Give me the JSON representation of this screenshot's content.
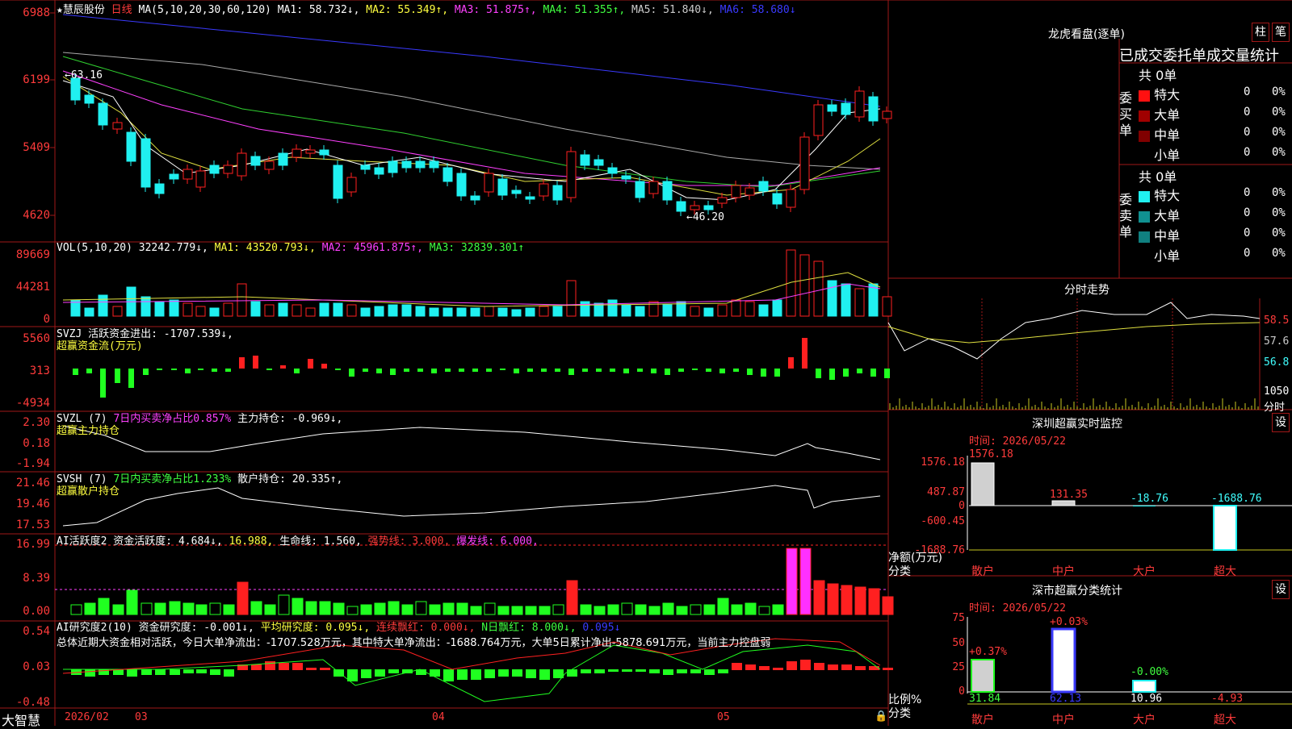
{
  "colors": {
    "up": "#ff2020",
    "down": "#20f0f0",
    "grid": "#a01818",
    "bg": "#000000",
    "yellow": "#ffff40",
    "magenta": "#ff40ff",
    "green": "#40ff40",
    "blue": "#3a3aff"
  },
  "main": {
    "title_star": "★",
    "stock_name": "慧辰股份",
    "period": "日线",
    "ma_params": "MA(5,10,20,30,60,120)",
    "ma1": "MA1: 58.732↓,",
    "ma2": "MA2: 55.349↑,",
    "ma3": "MA3: 51.875↑,",
    "ma4": "MA4: 51.355↑,",
    "ma5": "MA5: 51.840↓,",
    "ma6": "MA6: 58.680↓",
    "y_ticks": [
      "6988",
      "6199",
      "5409",
      "4620"
    ],
    "high_label": "63.16",
    "low_label": "46.20"
  },
  "vol": {
    "params": "VOL(5,10,20)",
    "value": "32242.779↓,",
    "ma1": "MA1: 43520.793↓,",
    "ma2": "MA2: 45961.875↑,",
    "ma3": "MA3: 32839.301↑",
    "y_ticks": [
      "89669",
      "44281",
      "0"
    ]
  },
  "svzj": {
    "line1": "SVZJ  活跃资金进出: -1707.539↓,",
    "line2": "超赢资金流(万元)",
    "y_ticks": [
      "5560",
      "313",
      "-4934"
    ]
  },
  "svzl": {
    "label": "SVZL (7) ",
    "ratio": "7日内买卖净占比0.857%",
    "main": "主力持仓: -0.969↓,",
    "line2": "超赢主力持仓",
    "y_ticks": [
      "2.30",
      "0.18",
      "-1.94"
    ]
  },
  "svsh": {
    "label": "SVSH (7) ",
    "ratio": "7日内买卖净占比1.233%",
    "retail": "散户持仓: 20.335↑,",
    "line2": "超赢散户持仓",
    "y_ticks": [
      "21.46",
      "19.46",
      "17.53"
    ]
  },
  "ai_active": {
    "label": "AI活跃度2 资金活跃度: 4.684↓,",
    "v2": "16.988,",
    "life": "生命线: 1.560,",
    "strong": "强势线: 3.000,",
    "burst": "爆发线: 6.000,",
    "y_ticks": [
      "16.99",
      "8.39",
      "0.00"
    ]
  },
  "ai_research": {
    "label": "AI研究度2(10) 资金研究度: -0.001↓,",
    "avg": "平均研究度: 0.095↓,",
    "red": "连续飘红: 0.000↓,",
    "nred": "N日飘红: 8.000↓,",
    "last": "0.095↓",
    "summary": "总体近期大资金相对活跃，今日大单净流出：-1707.528万元，其中特大单净流出：-1688.764万元，大单5日累计净出-5878.691万元，当前主力控盘弱",
    "y_ticks": [
      "0.54",
      "0.03",
      "-0.48"
    ]
  },
  "bottom_bar": {
    "brand": "大智慧",
    "dates": [
      "2026/02",
      "03",
      "04",
      "05"
    ]
  },
  "longhu": {
    "title": "龙虎看盘(逐单)",
    "tab1": "柱",
    "tab2": "笔",
    "header": "已成交委托单成交量统计",
    "buy_group": "委买单",
    "sell_group": "委卖单",
    "buy_total": "共 0单",
    "sell_total": "共 0单",
    "buy_rows": [
      {
        "name": "特大",
        "count": "0",
        "pct": "0%",
        "color": "#ff1010"
      },
      {
        "name": "大单",
        "count": "0",
        "pct": "0%",
        "color": "#a00000"
      },
      {
        "name": "中单",
        "count": "0",
        "pct": "0%",
        "color": "#800000"
      },
      {
        "name": "小单",
        "count": "0",
        "pct": "0%",
        "color": "#000000"
      }
    ],
    "sell_rows": [
      {
        "name": "特大",
        "count": "0",
        "pct": "0%",
        "color": "#20f0f0"
      },
      {
        "name": "大单",
        "count": "0",
        "pct": "0%",
        "color": "#109090"
      },
      {
        "name": "中单",
        "count": "0",
        "pct": "0%",
        "color": "#108080"
      },
      {
        "name": "小单",
        "count": "0",
        "pct": "0%",
        "color": "#000000"
      }
    ]
  },
  "intraday": {
    "title": "分时走势",
    "prices": [
      "58.5",
      "57.6",
      "56.8"
    ],
    "volume": "1050",
    "vol_label": "分时"
  },
  "sz_monitor": {
    "title": "深圳超赢实时监控",
    "settings": "设",
    "time": "时间: 2026/05/22",
    "y_ticks": [
      "1576.18",
      "487.87",
      "0",
      "-600.45",
      "-1688.76"
    ],
    "ylabel": "净额(万元)",
    "xlabel": "分类",
    "categories": [
      "散户",
      "中户",
      "大户",
      "超大"
    ],
    "values": [
      "1576.18",
      "131.35",
      "-18.76",
      "-1688.76"
    ]
  },
  "sz_class": {
    "title": "深市超赢分类统计",
    "settings": "设",
    "time": "时间: 2026/05/22",
    "y_ticks": [
      "75",
      "50",
      "25",
      "0"
    ],
    "ylabel": "比例%",
    "xlabel": "分类",
    "categories": [
      "散户",
      "中户",
      "大户",
      "超大"
    ],
    "top_values": [
      "+0.37%",
      "+0.03%",
      "-0.00%",
      ""
    ],
    "bottom_values": [
      "31.84",
      "62.13",
      "10.96",
      "-4.93"
    ]
  },
  "chart_data": {
    "type": "candlestick",
    "price_range": [
      46.2,
      63.16
    ],
    "monitor_values": [
      1576.18,
      131.35,
      -18.76,
      -1688.76
    ],
    "class_ratio": [
      31.84,
      62.13,
      10.96,
      -4.93
    ]
  }
}
